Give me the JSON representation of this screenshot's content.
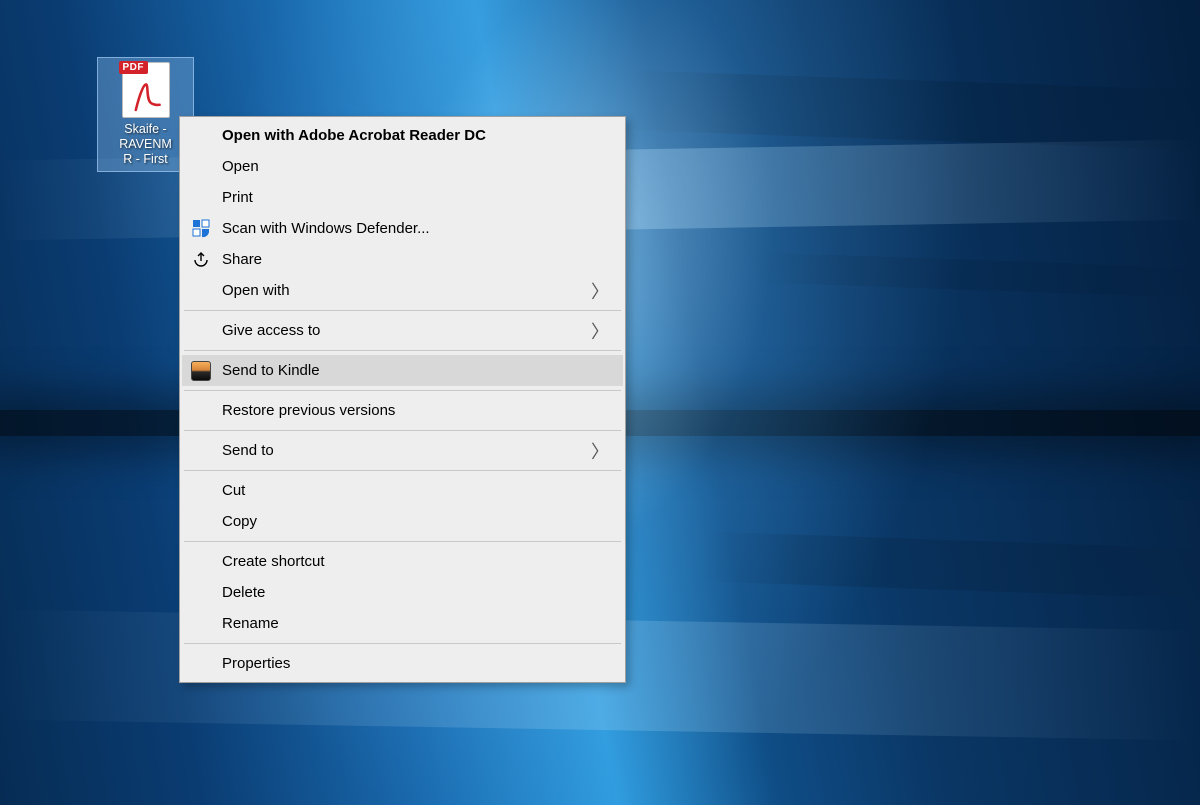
{
  "desktop": {
    "file": {
      "badge": "PDF",
      "name_line1": "Skaife -",
      "name_line2": "RAVENM",
      "name_line3": "R - First"
    }
  },
  "context_menu": {
    "open_with_default": "Open with Adobe Acrobat Reader DC",
    "open": "Open",
    "print": "Print",
    "scan_defender": "Scan with Windows Defender...",
    "share": "Share",
    "open_with": "Open with",
    "give_access_to": "Give access to",
    "send_to_kindle": "Send to Kindle",
    "restore_previous": "Restore previous versions",
    "send_to": "Send to",
    "cut": "Cut",
    "copy": "Copy",
    "create_shortcut": "Create shortcut",
    "delete": "Delete",
    "rename": "Rename",
    "properties": "Properties"
  }
}
